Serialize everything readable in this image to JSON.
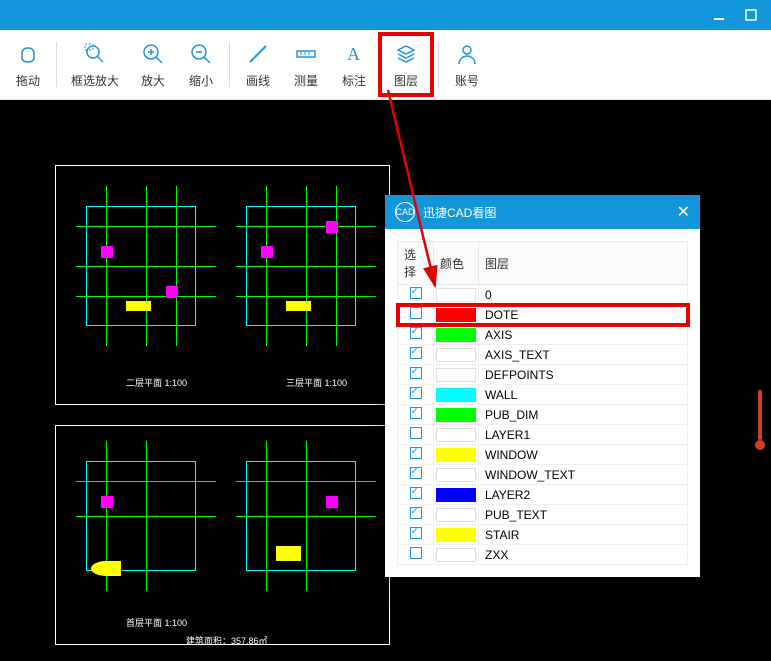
{
  "toolbar": {
    "items": [
      {
        "label": "拖动",
        "icon": "hand-icon"
      },
      {
        "label": "框选放大",
        "icon": "zoom-box-icon"
      },
      {
        "label": "放大",
        "icon": "zoom-in-icon"
      },
      {
        "label": "缩小",
        "icon": "zoom-out-icon"
      },
      {
        "label": "画线",
        "icon": "line-icon"
      },
      {
        "label": "测量",
        "icon": "measure-icon"
      },
      {
        "label": "标注",
        "icon": "annotate-icon"
      },
      {
        "label": "图层",
        "icon": "layers-icon"
      },
      {
        "label": "账号",
        "icon": "account-icon"
      }
    ]
  },
  "layers_panel": {
    "title": "迅捷CAD看图",
    "headers": {
      "select": "选择",
      "color": "颜色",
      "layer": "图层"
    },
    "rows": [
      {
        "checked": true,
        "color": "#ffffff",
        "name": "0"
      },
      {
        "checked": false,
        "color": "#ff0000",
        "name": "DOTE",
        "highlight": true
      },
      {
        "checked": true,
        "color": "#00ff00",
        "name": "AXIS"
      },
      {
        "checked": true,
        "color": "#ffffff",
        "name": "AXIS_TEXT"
      },
      {
        "checked": true,
        "color": "#ffffff",
        "name": "DEFPOINTS"
      },
      {
        "checked": true,
        "color": "#00ffff",
        "name": "WALL"
      },
      {
        "checked": true,
        "color": "#00ff00",
        "name": "PUB_DIM"
      },
      {
        "checked": false,
        "color": "#ffffff",
        "name": "LAYER1"
      },
      {
        "checked": true,
        "color": "#ffff00",
        "name": "WINDOW"
      },
      {
        "checked": true,
        "color": "#ffffff",
        "name": "WINDOW_TEXT"
      },
      {
        "checked": true,
        "color": "#0000ff",
        "name": "LAYER2"
      },
      {
        "checked": true,
        "color": "#ffffff",
        "name": "PUB_TEXT"
      },
      {
        "checked": true,
        "color": "#ffff00",
        "name": "STAIR"
      },
      {
        "checked": false,
        "color": "#ffffff",
        "name": "ZXX"
      }
    ]
  },
  "drawing": {
    "caption1": "二层平面 1:100",
    "caption2": "三层平面 1:100",
    "caption3": "首层平面 1:100",
    "footer": "建筑面积：357.86㎡"
  }
}
